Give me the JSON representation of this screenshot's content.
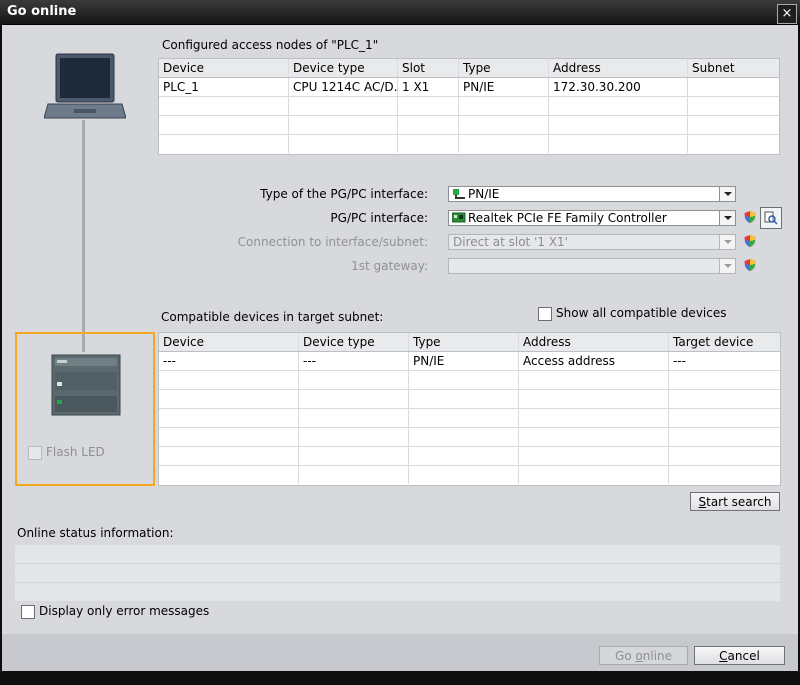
{
  "window": {
    "title": "Go online",
    "close_glyph": "×"
  },
  "configured": {
    "heading": "Configured access nodes of \"PLC_1\"",
    "columns": [
      "Device",
      "Device type",
      "Slot",
      "Type",
      "Address",
      "Subnet"
    ],
    "rows": [
      [
        "PLC_1",
        "CPU 1214C AC/D...",
        "1 X1",
        "PN/IE",
        "172.30.30.200",
        ""
      ]
    ]
  },
  "interface": {
    "type_label": "Type of the PG/PC interface:",
    "type_value": "PN/IE",
    "pgpc_label": "PG/PC interface:",
    "pgpc_value": "Realtek PCIe FE Family Controller",
    "connection_label": "Connection to interface/subnet:",
    "connection_value": "Direct at slot '1 X1'",
    "gateway_label": "1st gateway:",
    "gateway_value": ""
  },
  "compatible": {
    "heading": "Compatible devices in target subnet:",
    "show_all_label": "Show all compatible devices",
    "columns": [
      "Device",
      "Device type",
      "Type",
      "Address",
      "Target device"
    ],
    "rows": [
      [
        "---",
        "---",
        "PN/IE",
        "Access address",
        "---"
      ]
    ]
  },
  "flash_led_label": "Flash LED",
  "start_search": {
    "underlined": "S",
    "rest": "tart search"
  },
  "status": {
    "heading": "Online status information:"
  },
  "error_only_label": "Display only error messages",
  "go_online": {
    "before": "Go ",
    "underlined": "o",
    "after": "nline"
  },
  "cancel": {
    "underlined": "C",
    "rest": "ancel"
  },
  "colors": {
    "highlight_border": "#f5a623",
    "dialog_bg": "#d8d9dd",
    "green_status": "#27a844"
  },
  "icons": [
    "laptop-icon",
    "plc-device-icon",
    "network-card-icon",
    "ethernet-icon",
    "shield-icon",
    "properties-icon",
    "close-icon"
  ]
}
